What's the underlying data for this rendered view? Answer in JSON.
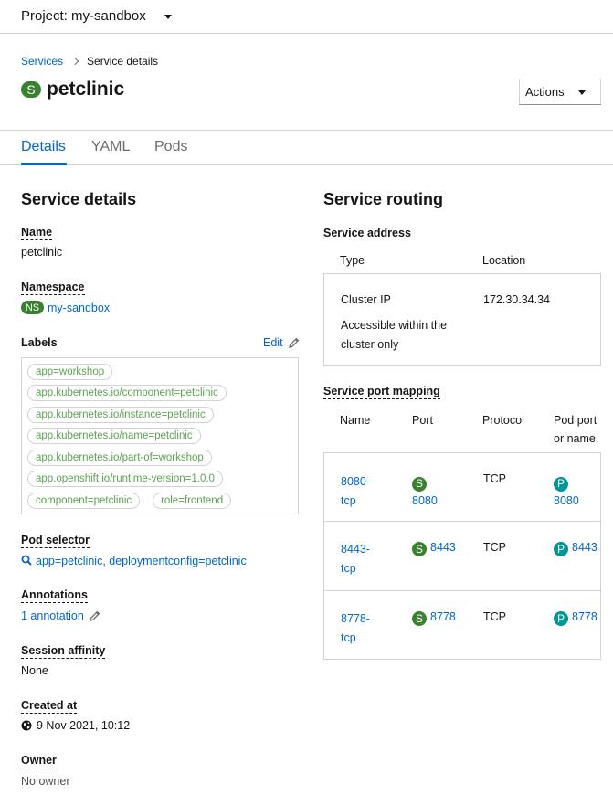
{
  "project": {
    "label": "Project: my-sandbox"
  },
  "breadcrumb": {
    "parent": "Services",
    "current": "Service details"
  },
  "title": {
    "badge": "S",
    "name": "petclinic"
  },
  "actions": {
    "label": "Actions"
  },
  "tabs": [
    {
      "label": "Details"
    },
    {
      "label": "YAML"
    },
    {
      "label": "Pods"
    }
  ],
  "details": {
    "heading": "Service details",
    "name_label": "Name",
    "name_value": "petclinic",
    "namespace_label": "Namespace",
    "namespace_badge": "NS",
    "namespace_value": "my-sandbox",
    "labels_label": "Labels",
    "edit_label": "Edit",
    "labels": [
      "app=workshop",
      "app.kubernetes.io/component=petclinic",
      "app.kubernetes.io/instance=petclinic",
      "app.kubernetes.io/name=petclinic",
      "app.kubernetes.io/part-of=workshop",
      "app.openshift.io/runtime-version=1.0.0",
      "component=petclinic",
      "role=frontend"
    ],
    "pod_selector_label": "Pod selector",
    "pod_selector_value": "app=petclinic, deploymentconfig=petclinic",
    "annotations_label": "Annotations",
    "annotations_value": "1 annotation",
    "session_affinity_label": "Session affinity",
    "session_affinity_value": "None",
    "created_label": "Created at",
    "created_value": "9 Nov 2021, 10:12",
    "owner_label": "Owner",
    "owner_value": "No owner"
  },
  "routing": {
    "heading": "Service routing",
    "address_label": "Service address",
    "address_cols": {
      "type": "Type",
      "location": "Location"
    },
    "address_row": {
      "type": "Cluster IP",
      "location": "172.30.34.34",
      "note": "Accessible within the cluster only"
    },
    "port_mapping_label": "Service port mapping",
    "port_cols": {
      "name": "Name",
      "port": "Port",
      "protocol": "Protocol",
      "pod_port_1": "Pod port",
      "pod_port_2": "or name"
    },
    "ports": [
      {
        "name_1": "8080-",
        "name_2": "tcp",
        "port": "8080",
        "protocol": "TCP",
        "pod_port": "8080"
      },
      {
        "name_1": "8443-",
        "name_2": "tcp",
        "port": "8443",
        "protocol": "TCP",
        "pod_port": "8443"
      },
      {
        "name_1": "8778-",
        "name_2": "tcp",
        "port": "8778",
        "protocol": "TCP",
        "pod_port": "8778"
      }
    ],
    "service_badge": "S",
    "pod_badge": "P"
  },
  "colors": {
    "link": "#0066cc",
    "service_badge": "#38812f",
    "pod_badge": "#009596",
    "label_text": "#5ba352"
  }
}
